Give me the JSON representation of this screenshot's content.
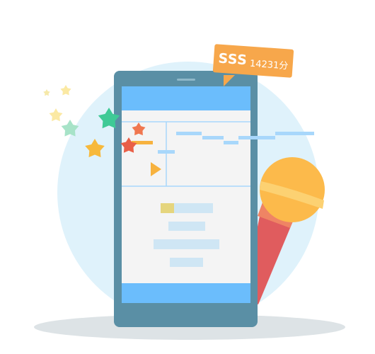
{
  "score_badge": {
    "rank": "SSS",
    "points": "14231分",
    "color": "#f7a74b"
  },
  "colors": {
    "backdrop_circle": "#dff2fb",
    "floor_shadow": "#dde3e6",
    "phone_body": "#5a8fa5",
    "screen_background": "#f4f4f4",
    "screen_bars": "#6bbdfc",
    "pitch_segments": "#a8d7fb",
    "progress_bar": "#e5d57d",
    "text_placeholders": "#cfe6f4",
    "play_indicator": "#f7b23e",
    "mic_head": "#fcba4b",
    "mic_band": "#fcd172",
    "mic_handle": "#e05c5e",
    "stars": [
      "#f6e9a9",
      "#fbe9a3",
      "#a7e3c8",
      "#f7b93b",
      "#3fca96",
      "#f07750",
      "#e95f47"
    ]
  },
  "icons": {
    "microphone": "microphone-icon",
    "play": "play-triangle-icon",
    "stars": "star-icon"
  }
}
